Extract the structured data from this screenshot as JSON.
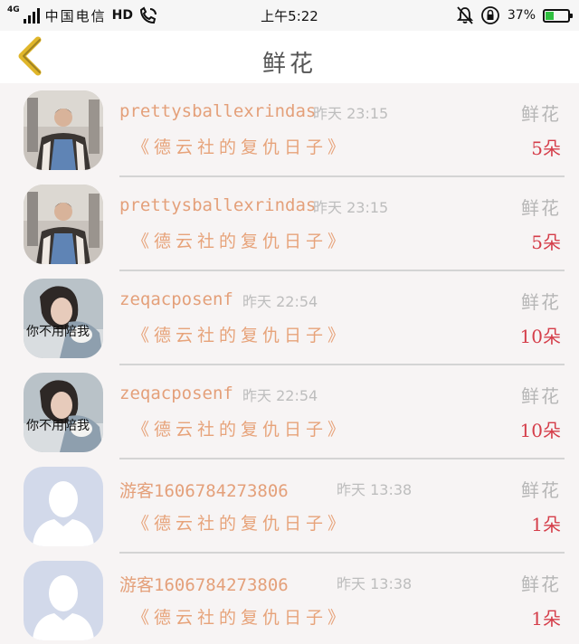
{
  "status_bar": {
    "network": "4G",
    "carrier": "中国电信",
    "hd": "HD",
    "time": "上午5:22",
    "battery_percent": "37%",
    "battery_level": 0.37
  },
  "header": {
    "title": "鲜花",
    "back_icon": "chevron-left-icon",
    "accent_color": "#e0b62a"
  },
  "records": [
    {
      "username": "prettysballexrindas",
      "time": "昨天 23:15",
      "gift": "鲜花",
      "drama": "《德云社的复仇日子》",
      "count": "5朵",
      "avatar": "man-photo"
    },
    {
      "username": "prettysballexrindas",
      "time": "昨天 23:15",
      "gift": "鲜花",
      "drama": "《德云社的复仇日子》",
      "count": "5朵",
      "avatar": "man-photo"
    },
    {
      "username": "zeqacposenf",
      "time": "昨天 22:54",
      "gift": "鲜花",
      "drama": "《德云社的复仇日子》",
      "count": "10朵",
      "avatar": "woman-photo",
      "avatar_caption": "你不用陪我"
    },
    {
      "username": "zeqacposenf",
      "time": "昨天 22:54",
      "gift": "鲜花",
      "drama": "《德云社的复仇日子》",
      "count": "10朵",
      "avatar": "woman-photo",
      "avatar_caption": "你不用陪我"
    },
    {
      "username": "游客1606784273806",
      "time": "昨天 13:38",
      "gift": "鲜花",
      "drama": "《德云社的复仇日子》",
      "count": "1朵",
      "avatar": "default-user"
    },
    {
      "username": "游客1606784273806",
      "time": "昨天 13:38",
      "gift": "鲜花",
      "drama": "《德云社的复仇日子》",
      "count": "1朵",
      "avatar": "default-user"
    }
  ]
}
